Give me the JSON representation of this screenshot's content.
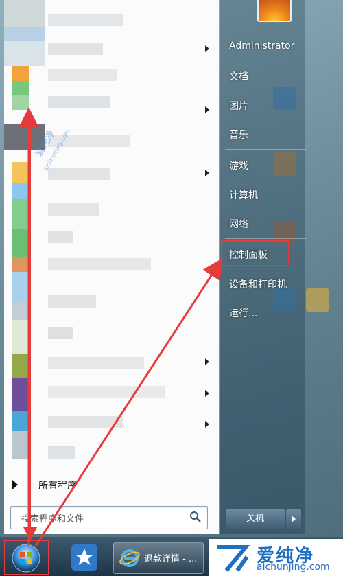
{
  "start_menu": {
    "all_programs": "所有程序",
    "search_placeholder": "搜索程序和文件",
    "right_items": [
      {
        "label": "Administrator"
      },
      {
        "label": "文档"
      },
      {
        "label": "图片"
      },
      {
        "label": "音乐"
      },
      {
        "label": "游戏"
      },
      {
        "label": "计算机"
      },
      {
        "label": "网络"
      },
      {
        "label": "控制面板"
      },
      {
        "label": "设备和打印机"
      },
      {
        "label": "运行..."
      }
    ],
    "shutdown_label": "关机"
  },
  "taskbar": {
    "ie_window_label": "退款详情 - ..."
  },
  "watermark": {
    "cn": "爱纯净",
    "en": "aichunjing.com"
  },
  "icons": [
    "start-orb-icon",
    "search-icon",
    "star-app-icon",
    "ie-icon",
    "avatar-flower-icon",
    "shutdown-arrow-icon"
  ],
  "colors": {
    "annotation": "#e53b3b",
    "watermark_blue": "#1f6fc4"
  }
}
